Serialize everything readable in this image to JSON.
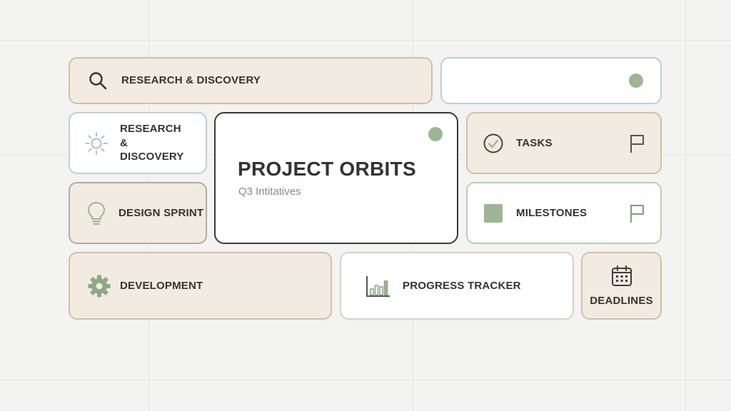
{
  "cards": {
    "research_top": {
      "label": "RESEARCH & DISCOVERY",
      "icon": "search-icon"
    },
    "research_side": {
      "label": "RESEARCH & DISCOVERY",
      "icon": "sun-icon"
    },
    "design": {
      "label": "DESIGN SPRINT",
      "icon": "lightbulb-icon"
    },
    "development": {
      "label": "DEVELOPMENT",
      "icon": "gear-icon"
    },
    "progress": {
      "label": "PROGRESS TRACKER",
      "icon": "bar-chart-icon"
    },
    "deadlines": {
      "label": "DEADLINES",
      "icon": "calendar-icon"
    },
    "tasks": {
      "label": "TASKS",
      "icon": "check-circle-icon",
      "flag_icon": "flag-icon"
    },
    "milestones": {
      "label": "MILESTONES",
      "icon": "square-icon",
      "flag_icon": "flag-icon"
    }
  },
  "main": {
    "title": "PROJECT ORBITS",
    "subtitle": "Q3 Intitatives"
  },
  "colors": {
    "accent_green": "#9cb693",
    "beige": "#f2ebe1",
    "blue_border": "#b8d0e0",
    "green_border": "#b6cfae"
  }
}
